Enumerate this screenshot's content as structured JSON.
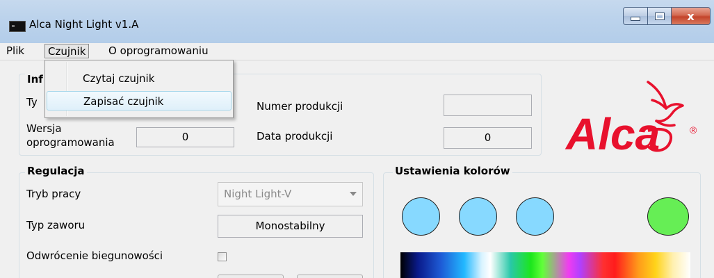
{
  "window": {
    "title": "Alca Night Light  v1.A",
    "close_glyph": "x"
  },
  "menubar": {
    "items": [
      {
        "label": "Plik"
      },
      {
        "label": "Czujnik"
      },
      {
        "label": "O oprogramowaniu"
      }
    ]
  },
  "dropdown": {
    "items": [
      {
        "label": "Czytaj czujnik"
      },
      {
        "label": "Zapisać czujnik"
      }
    ]
  },
  "info_group": {
    "title_visible": "Inf",
    "type_label_visible": "Ty",
    "version_label_line1": "Wersja",
    "version_label_line2": "oprogramowania",
    "version_value": "0",
    "serial_label": "Numer produkcji",
    "serial_value": "",
    "date_label": "Data produkcji",
    "date_value": "0"
  },
  "regulation_group": {
    "title": "Regulacja",
    "mode_label": "Tryb pracy",
    "mode_value": "Night Light-V",
    "valve_label": "Typ zaworu",
    "valve_value": "Monostabilny",
    "polarity_label": "Odwrócenie biegunowości",
    "polarity_checked": false
  },
  "colors_group": {
    "title": "Ustawienia kolorów",
    "swatches": [
      "#87d9ff",
      "#87d9ff",
      "#87d9ff",
      "#66ee55"
    ]
  },
  "logo": {
    "text": "Alca",
    "registered": "®",
    "brand_color": "#e8112d"
  }
}
